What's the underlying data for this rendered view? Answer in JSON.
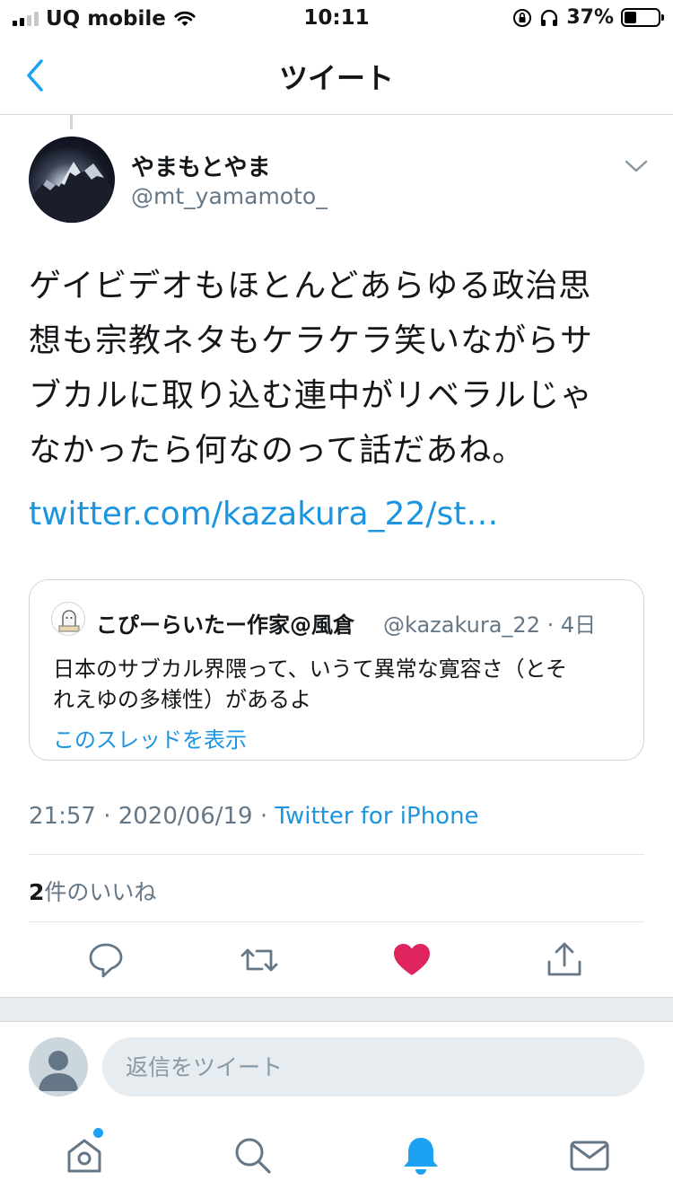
{
  "status_bar": {
    "carrier": "UQ mobile",
    "time": "10:11",
    "battery_percent": "37%",
    "battery_level": 0.37
  },
  "nav": {
    "title": "ツイート",
    "back_icon": "chevron-left-icon"
  },
  "tweet": {
    "display_name": "やまもとやま",
    "handle": "@mt_yamamoto_",
    "text_lines": [
      "ゲイビデオもほとんどあらゆる政治思",
      "想も宗教ネタもケラケラ笑いながらサ",
      "ブカルに取り込む連中がリベラルじゃ",
      "なかったら何なのって話だあね。"
    ],
    "link": "twitter.com/kazakura_22/st…",
    "timestamp": "21:57 · 2020/06/19 · ",
    "source": "Twitter for iPhone",
    "likes_count": "2",
    "likes_label": "件のいいね"
  },
  "quote": {
    "display_name": "こぴーらいたー作家@風倉",
    "meta": "@kazakura_22 · 4日",
    "text_lines": [
      "日本のサブカル界隈って、いうて異常な寛容さ（とそ",
      "れえゆの多様性）があるよ"
    ],
    "thread_link": "このスレッドを表示"
  },
  "reply": {
    "placeholder": "返信をツイート"
  },
  "colors": {
    "accent": "#1b95e0",
    "like": "#e0245e",
    "secondary_text": "#657786",
    "border": "#e1e8ed"
  }
}
